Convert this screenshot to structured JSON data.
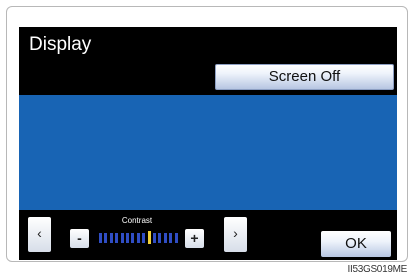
{
  "screen": {
    "title": "Display",
    "screen_off_label": "Screen Off",
    "ok_label": "OK"
  },
  "contrast": {
    "label": "Contrast",
    "minus_label": "-",
    "plus_label": "+",
    "left_arrow": "‹",
    "right_arrow": "›",
    "segments": 15,
    "level": 9
  },
  "figure_code": "II53GS019ME",
  "colors": {
    "background": "#000000",
    "display_area": "#1864b4",
    "meter_inactive": "#2f4dc4",
    "meter_active": "#f2d238"
  }
}
